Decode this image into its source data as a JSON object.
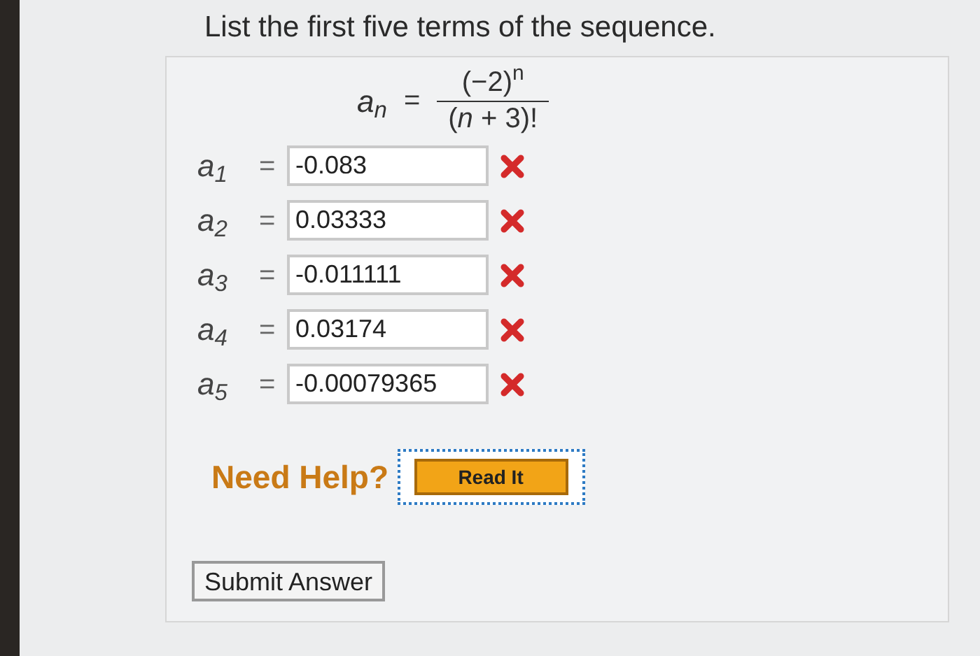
{
  "question": "List the first five terms of the sequence.",
  "formula": {
    "lhs": "a$_{n}$",
    "equals": "=",
    "numerator": "(−2)$^{n}$",
    "denominator": "(*n* + 3)!"
  },
  "answers": [
    {
      "label": "a$_{1}$",
      "equals": "=",
      "value": "-0.083",
      "correct": false
    },
    {
      "label": "a$_{2}$",
      "equals": "=",
      "value": "0.03333",
      "correct": false
    },
    {
      "label": "a$_{3}$",
      "equals": "=",
      "value": "-0.011111",
      "correct": false
    },
    {
      "label": "a$_{4}$",
      "equals": "=",
      "value": "0.03174",
      "correct": false
    },
    {
      "label": "a$_{5}$",
      "equals": "=",
      "value": "-0.00079365",
      "correct": false
    }
  ],
  "help": {
    "label": "Need Help?",
    "button": "Read It"
  },
  "submit": "Submit Answer"
}
